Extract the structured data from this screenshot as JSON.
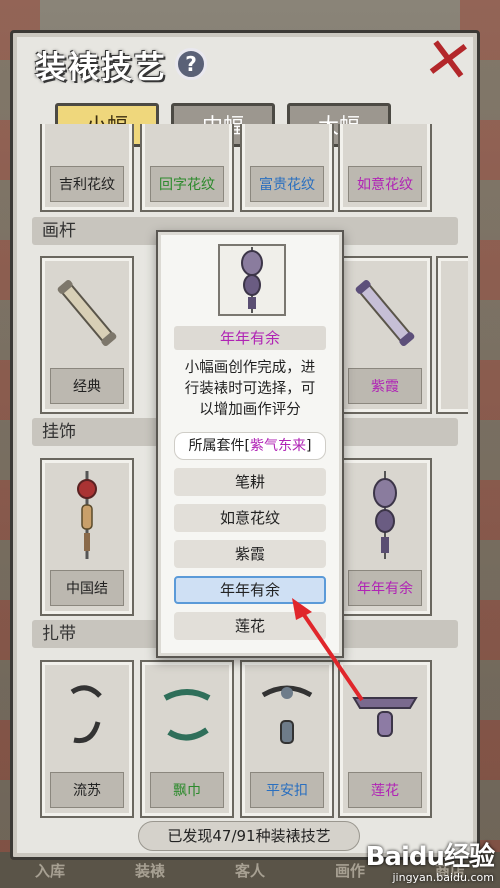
{
  "header": {
    "title": "装裱技艺",
    "help_symbol": "?"
  },
  "close_symbol": "✕",
  "tabs": [
    {
      "label": "小幅",
      "active": true
    },
    {
      "label": "中幅",
      "active": false
    },
    {
      "label": "大幅",
      "active": false
    }
  ],
  "sections": {
    "top_row": [
      "吉利花纹",
      "回字花纹",
      "富贵花纹",
      "如意花纹"
    ],
    "huagan": {
      "title": "画杆",
      "items": [
        "经典",
        "紫霞"
      ]
    },
    "guashi": {
      "title": "挂饰",
      "items": [
        "中国结",
        "年年有余"
      ]
    },
    "zadai": {
      "title": "扎带",
      "items": [
        "流苏",
        "飘巾",
        "平安扣",
        "莲花"
      ]
    }
  },
  "discover_text": "已发现47/91种装裱技艺",
  "popup": {
    "name": "年年有余",
    "description_lines": [
      "小幅画创作完成，进",
      "行装裱时可选择，可",
      "以增加画作评分"
    ],
    "set_prefix": "所属套件[",
    "set_name": "紫气东来",
    "set_suffix": "]",
    "options": [
      "笔耕",
      "如意花纹",
      "紫霞",
      "年年有余",
      "莲花"
    ],
    "selected_option": "年年有余"
  },
  "bottom_bar": [
    "入库",
    "装裱",
    "客人",
    "画作",
    "商店"
  ],
  "watermark": {
    "brand": "Baidu经验",
    "url": "jingyan.baidu.com"
  },
  "colors": {
    "purple_text": "#b023b5",
    "green_text": "#2c8a2c",
    "blue_text": "#2a6fbf",
    "active_tab": "#efd77c",
    "close_red": "#b3272a"
  }
}
